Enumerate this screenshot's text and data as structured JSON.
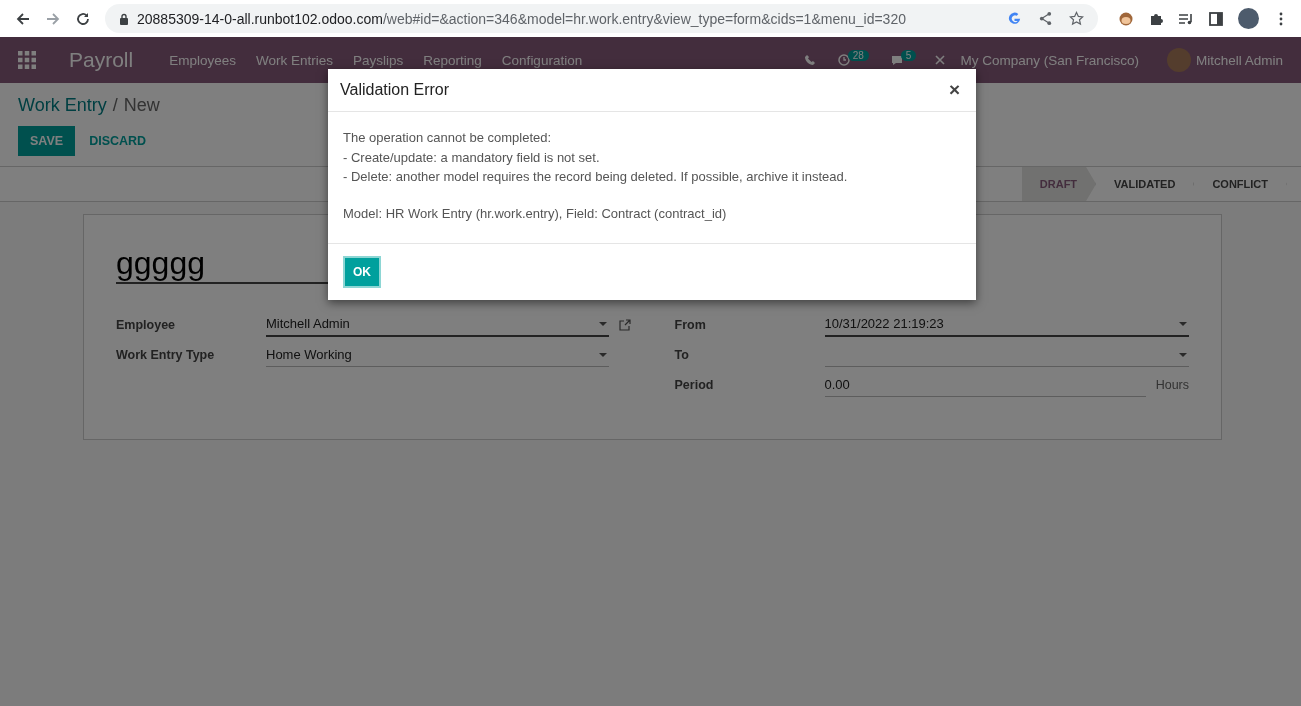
{
  "browser": {
    "url_host": "20885309-14-0-all.runbot102.odoo.com",
    "url_path": "/web#id=&action=346&model=hr.work.entry&view_type=form&cids=1&menu_id=320"
  },
  "navbar": {
    "app": "Payroll",
    "menu": [
      "Employees",
      "Work Entries",
      "Payslips",
      "Reporting",
      "Configuration"
    ],
    "activity_count": "28",
    "message_count": "5",
    "company": "My Company (San Francisco)",
    "user": "Mitchell Admin"
  },
  "breadcrumb": {
    "parent": "Work Entry",
    "separator": "/",
    "current": "New"
  },
  "buttons": {
    "save": "SAVE",
    "discard": "DISCARD"
  },
  "statusbar": [
    {
      "label": "DRAFT",
      "selected": true
    },
    {
      "label": "VALIDATED",
      "selected": false
    },
    {
      "label": "CONFLICT",
      "selected": false
    }
  ],
  "form": {
    "name": "ggggg",
    "left": [
      {
        "label": "Employee",
        "value": "Mitchell Admin",
        "kind": "dropdown",
        "required": true,
        "external_link": true
      },
      {
        "label": "Work Entry Type",
        "value": "Home Working",
        "kind": "dropdown",
        "required": false,
        "external_link": false
      }
    ],
    "right": [
      {
        "label": "From",
        "value": "10/31/2022 21:19:23",
        "kind": "dropdown",
        "required": true
      },
      {
        "label": "To",
        "kind": "dropdown",
        "required": false
      },
      {
        "label": "Period",
        "value": "0.00",
        "kind": "number",
        "unit": "Hours",
        "required": false
      }
    ]
  },
  "dialog": {
    "title": "Validation Error",
    "close": "×",
    "paragraphs": [
      [
        "The operation cannot be completed:",
        "- Create/update: a mandatory field is not set.",
        "- Delete: another model requires the record being deleted. If possible, archive it instead."
      ],
      [
        "Model: HR Work Entry (hr.work.entry), Field: Contract (contract_id)"
      ]
    ],
    "button": "OK"
  }
}
